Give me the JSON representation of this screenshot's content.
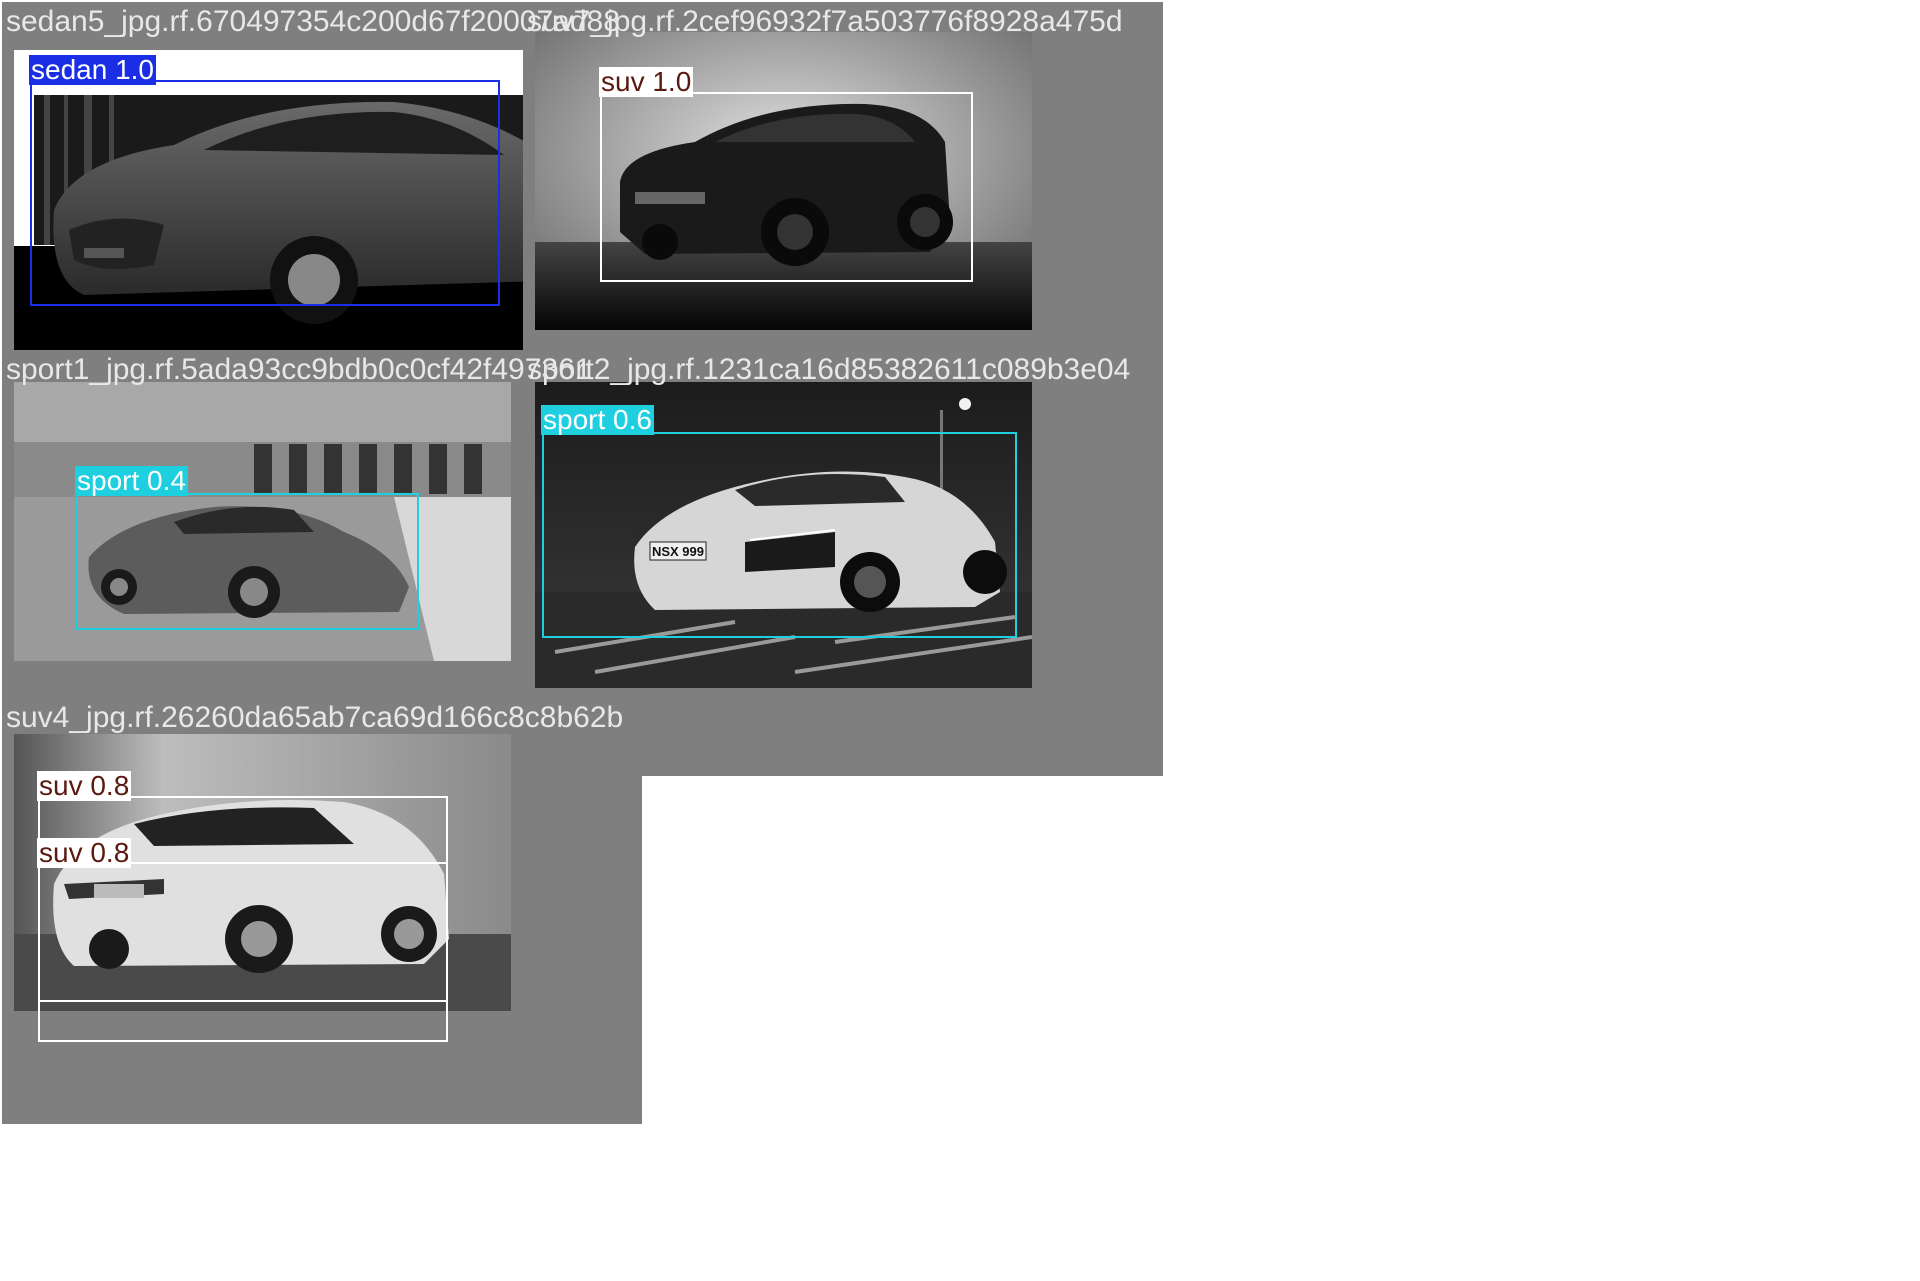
{
  "colors": {
    "tile_background": "#7f7f7f",
    "sedan": "#1a2ee6",
    "suv": "#ffffff",
    "sport": "#1ecfe0",
    "suv_label_text": "#5a1a10",
    "sedan_label_text": "#ffffff",
    "sport_label_text": "#ffffff"
  },
  "tiles": [
    {
      "filename": "sedan5_jpg.rf.670497354c200d67f20007ad88",
      "detections": [
        {
          "label": "sedan 1.0",
          "class": "sedan",
          "confidence": 1.0
        }
      ]
    },
    {
      "filename": "suv7_jpg.rf.2cef96932f7a503776f8928a475d",
      "detections": [
        {
          "label": "suv 1.0",
          "class": "suv",
          "confidence": 1.0
        }
      ]
    },
    {
      "filename": "sport1_jpg.rf.5ada93cc9bdb0c0cf42f497361",
      "detections": [
        {
          "label": "sport 0.4",
          "class": "sport",
          "confidence": 0.4
        }
      ]
    },
    {
      "filename": "sport2_jpg.rf.1231ca16d85382611c089b3e04",
      "detections": [
        {
          "label": "sport 0.6",
          "class": "sport",
          "confidence": 0.6
        }
      ],
      "plate_text": "NSX 999"
    },
    {
      "filename": "suv4_jpg.rf.26260da65ab7ca69d166c8c8b62b",
      "detections": [
        {
          "label": "suv 0.8",
          "class": "suv",
          "confidence": 0.8
        },
        {
          "label": "suv 0.8",
          "class": "suv",
          "confidence": 0.8
        }
      ]
    }
  ]
}
